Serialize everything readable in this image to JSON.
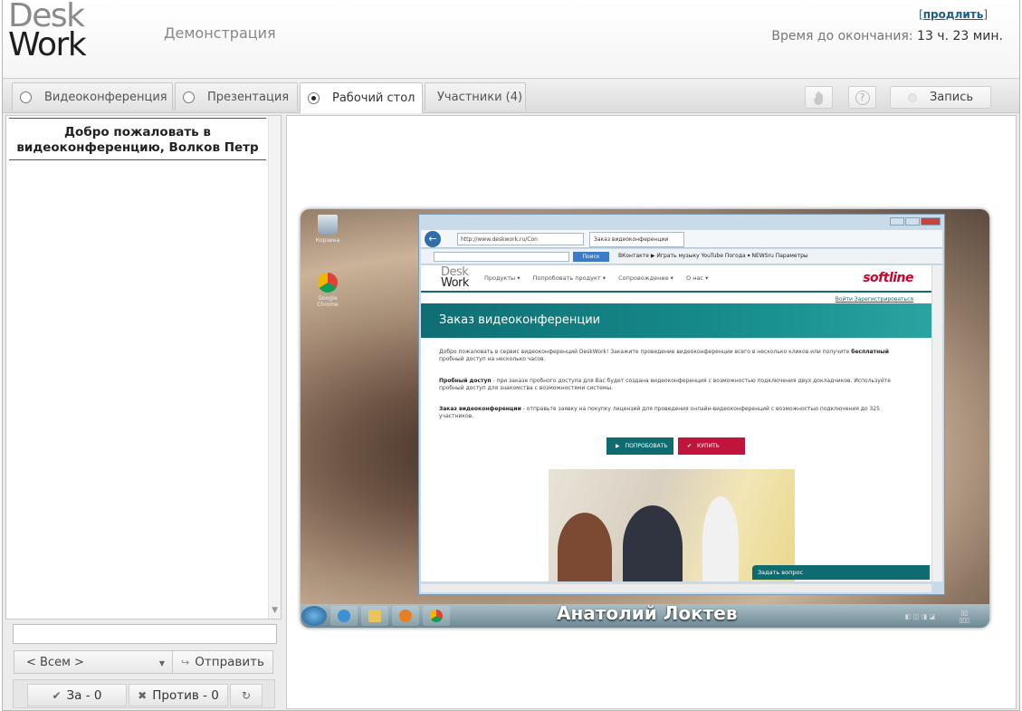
{
  "header": {
    "logo_desk": "Desk",
    "logo_work": "Work",
    "title": "Демонстрация",
    "extend_open": "[",
    "extend_label": "продлить",
    "extend_close": "]",
    "time_label": "Время до окончания:",
    "time_value": "13 ч. 23 мин."
  },
  "tabs": [
    {
      "label": "Видеоконференция",
      "selected": false
    },
    {
      "label": "Презентация",
      "selected": false
    },
    {
      "label": "Рабочий стол",
      "selected": true
    },
    {
      "label": "Участники (4)"
    }
  ],
  "toolbar": {
    "hand_icon": "hand-icon",
    "help_icon": "help-icon",
    "help_glyph": "?",
    "record_label": "Запись"
  },
  "chat": {
    "welcome": "Добро пожаловать в видеоконференцию, Волков Петр",
    "input_value": "",
    "recipient": "< Всем >",
    "send_label": "Отправить"
  },
  "vote": {
    "for_label": "За - 0",
    "against_label": "Против - 0"
  },
  "shared_screen": {
    "presenter": "Анатолий Локтев",
    "desktop_icons": [
      "Корзина",
      "Google Chrome"
    ],
    "browser": {
      "address": "http://www.deskwork.ru/Con",
      "tab_title": "Заказ видеоконференции",
      "search_button": "Поиск",
      "toolbar_links": "ВКонтакте  ▶ Играть музыку  YouTube  Погода ▾  NEWSru  Параметры"
    },
    "site": {
      "logo_desk": "Desk",
      "logo_work": "Work",
      "menu": [
        "Продукты ▾",
        "Попробовать продукт ▾",
        "Сопровождение ▾",
        "О нас ▾"
      ],
      "brand": "softline",
      "login": "Войти",
      "register": "Зарегистрироваться",
      "heading": "Заказ видеоконференции",
      "intro": "Добро пожаловать в сервис видеоконференций DeskWork! Закажите проведение видеоконференции всего в несколько кликов или получите",
      "intro_bold": "бесплатный",
      "intro_end": "пробный доступ на несколько часов.",
      "trial_bold": "Пробный доступ",
      "trial_text": "- при заказе пробного доступа для Вас будет создана видеоконференция с возможностью подключения двух докладчиков. Используйте пробный доступ для знакомства с возможностями системы.",
      "order_bold": "Заказ видеоконференции",
      "order_text": "- отправьте заявку на покупку лицензий для проведения онлайн-видеоконференций с возможностью подключения до 325 участников.",
      "try_button": "ПОПРОБОВАТЬ",
      "buy_button": "КУПИТЬ",
      "ask_question": "Задать вопрос"
    }
  },
  "colors": {
    "teal": "#0e6b70",
    "buy_red": "#c0143c",
    "link_blue": "#1b5f8e"
  }
}
